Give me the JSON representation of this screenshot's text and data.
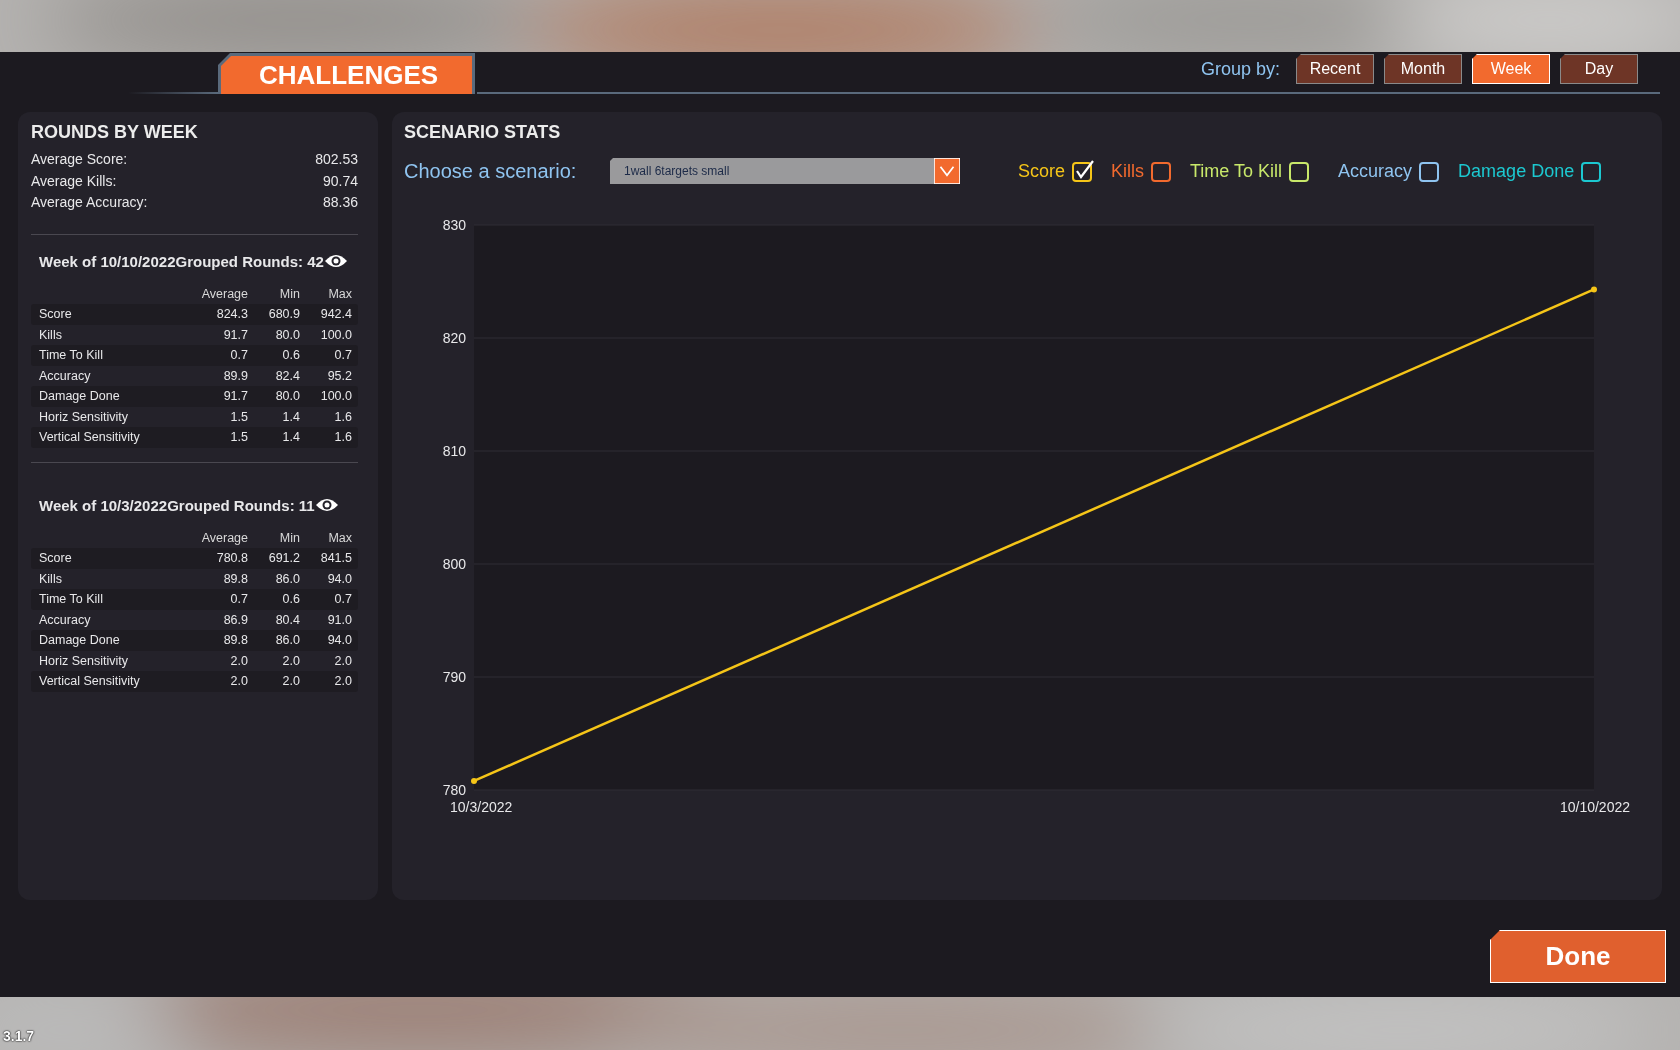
{
  "header": {
    "title": "CHALLENGES",
    "group_by_label": "Group by:",
    "group_by": [
      {
        "label": "Recent",
        "selected": false
      },
      {
        "label": "Month",
        "selected": false
      },
      {
        "label": "Week",
        "selected": true
      },
      {
        "label": "Day",
        "selected": false
      }
    ]
  },
  "rounds": {
    "title": "ROUNDS BY WEEK",
    "summary": [
      {
        "label": "Average Score:",
        "value": "802.53"
      },
      {
        "label": "Average Kills:",
        "value": "90.74"
      },
      {
        "label": "Average Accuracy:",
        "value": "88.36"
      }
    ],
    "weeks": [
      {
        "title": "Week of 10/10/2022Grouped Rounds: 42",
        "columns": [
          "Average",
          "Min",
          "Max"
        ],
        "rows": [
          {
            "label": "Score",
            "values": [
              "824.3",
              "680.9",
              "942.4"
            ]
          },
          {
            "label": "Kills",
            "values": [
              "91.7",
              "80.0",
              "100.0"
            ]
          },
          {
            "label": "Time To Kill",
            "values": [
              "0.7",
              "0.6",
              "0.7"
            ]
          },
          {
            "label": "Accuracy",
            "values": [
              "89.9",
              "82.4",
              "95.2"
            ]
          },
          {
            "label": "Damage Done",
            "values": [
              "91.7",
              "80.0",
              "100.0"
            ]
          },
          {
            "label": "Horiz Sensitivity",
            "values": [
              "1.5",
              "1.4",
              "1.6"
            ]
          },
          {
            "label": "Vertical Sensitivity",
            "values": [
              "1.5",
              "1.4",
              "1.6"
            ]
          }
        ]
      },
      {
        "title": "Week of 10/3/2022Grouped Rounds: 11",
        "columns": [
          "Average",
          "Min",
          "Max"
        ],
        "rows": [
          {
            "label": "Score",
            "values": [
              "780.8",
              "691.2",
              "841.5"
            ]
          },
          {
            "label": "Kills",
            "values": [
              "89.8",
              "86.0",
              "94.0"
            ]
          },
          {
            "label": "Time To Kill",
            "values": [
              "0.7",
              "0.6",
              "0.7"
            ]
          },
          {
            "label": "Accuracy",
            "values": [
              "86.9",
              "80.4",
              "91.0"
            ]
          },
          {
            "label": "Damage Done",
            "values": [
              "89.8",
              "86.0",
              "94.0"
            ]
          },
          {
            "label": "Horiz Sensitivity",
            "values": [
              "2.0",
              "2.0",
              "2.0"
            ]
          },
          {
            "label": "Vertical Sensitivity",
            "values": [
              "2.0",
              "2.0",
              "2.0"
            ]
          }
        ]
      }
    ]
  },
  "scenario": {
    "title": "SCENARIO STATS",
    "choose_label": "Choose a scenario:",
    "scenario_value": "1wall 6targets small",
    "legend": [
      {
        "label": "Score",
        "checked": true,
        "color": "#f5c518"
      },
      {
        "label": "Kills",
        "checked": false,
        "color": "#f26a2e"
      },
      {
        "label": "Time To Kill",
        "checked": false,
        "color": "#c8e86a"
      },
      {
        "label": "Accuracy",
        "checked": false,
        "color": "#8fc4f0"
      },
      {
        "label": "Damage Done",
        "checked": false,
        "color": "#1cc8d0"
      }
    ],
    "chart_data": {
      "type": "line",
      "categories": [
        "10/3/2022",
        "10/10/2022"
      ],
      "ylim": [
        780,
        830
      ],
      "yticks": [
        780,
        790,
        800,
        810,
        820,
        830
      ],
      "series": [
        {
          "color": "#f5c518",
          "marker": true,
          "values": [
            780.8,
            824.3
          ]
        }
      ]
    }
  },
  "done_button": "Done",
  "version": "3.1.7"
}
